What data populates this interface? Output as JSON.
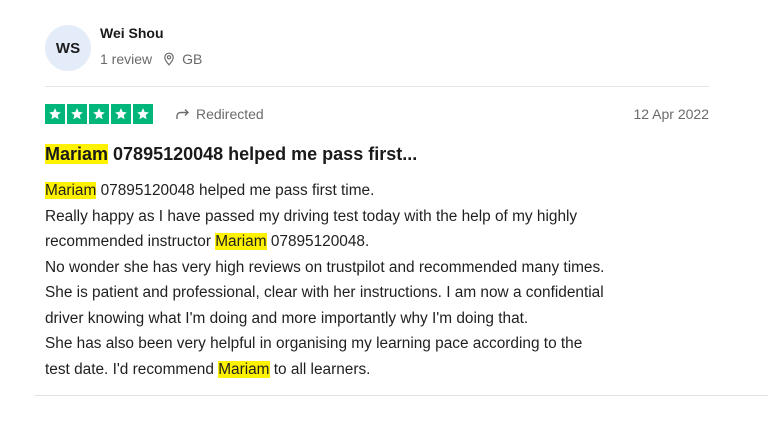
{
  "reviewer": {
    "initials": "WS",
    "name": "Wei Shou",
    "review_count": "1 review",
    "location": "GB"
  },
  "review": {
    "rating": 5,
    "rating_color": "#00b67a",
    "redirected_label": "Redirected",
    "date": "12 Apr 2022",
    "highlight_color": "#fff200",
    "title": {
      "highlight": "Mariam",
      "rest": " 07895120048 helped me pass first..."
    },
    "body": {
      "line1": {
        "highlight": "Mariam",
        "rest": " 07895120048 helped me pass first time."
      },
      "line2": "Really happy as I have passed my driving test today with the help of my highly",
      "line3": {
        "before": "recommended instructor ",
        "highlight": "Mariam",
        "after": " 07895120048."
      },
      "line4": "No wonder she has very high reviews on trustpilot and recommended many times.",
      "line5": "She is patient and professional, clear with her instructions. I am now a confidential",
      "line6": "driver knowing what I'm doing and more importantly why I'm doing that.",
      "line7": "She has also been very helpful in organising my learning pace according to the",
      "line8": {
        "before": "test date. I'd recommend ",
        "highlight": "Mariam",
        "after": " to all learners."
      }
    }
  }
}
